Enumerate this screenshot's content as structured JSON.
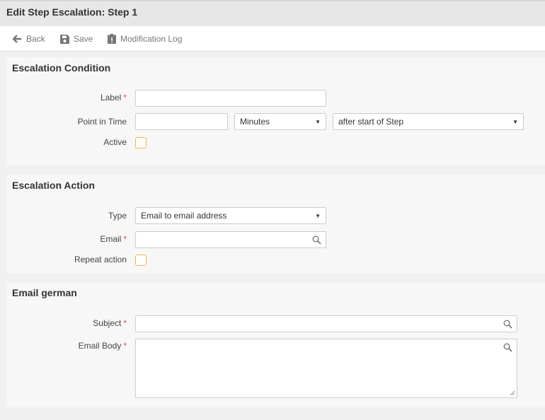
{
  "window": {
    "title": "Edit Step Escalation: Step 1"
  },
  "toolbar": {
    "back_label": "Back",
    "save_label": "Save",
    "modlog_label": "Modification Log"
  },
  "condition": {
    "title": "Escalation Condition",
    "label_label": "Label",
    "label_value": "",
    "point_label": "Point in Time",
    "point_value": "",
    "unit_value": "Minutes",
    "relation_value": "after start of Step",
    "active_label": "Active",
    "active_checked": false
  },
  "action": {
    "title": "Escalation Action",
    "type_label": "Type",
    "type_value": "Email to email address",
    "email_label": "Email",
    "email_value": "",
    "repeat_label": "Repeat action",
    "repeat_checked": false
  },
  "email": {
    "title": "Email german",
    "subject_label": "Subject",
    "subject_value": "",
    "body_label": "Email Body",
    "body_value": ""
  },
  "required_marker": "*",
  "colors": {
    "required": "#d9534f",
    "checkbox_border": "#e8b84a",
    "titlebar_bg": "#e7e7e7",
    "panel_bg": "#f7f7f7"
  }
}
